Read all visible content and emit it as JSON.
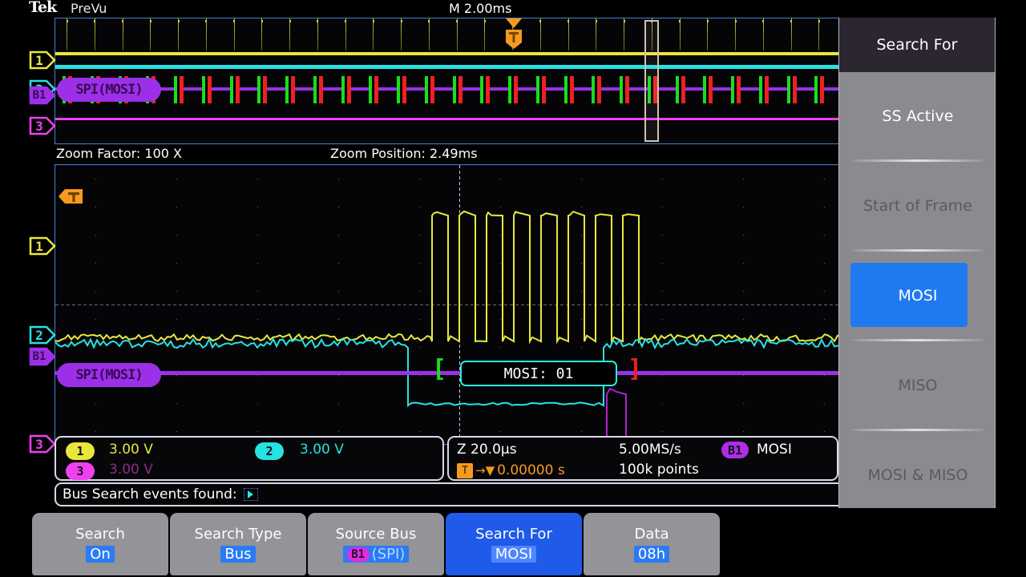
{
  "header": {
    "brand": "Tek",
    "mode": "PreVu",
    "horizontal_scale": "M 2.00ms"
  },
  "overview": {
    "bus_label": "SPI(MOSI)",
    "trigger_marker": "T",
    "channels": [
      {
        "name": "1",
        "color": "#e8e83c"
      },
      {
        "name": "2",
        "color": "#27e2e2"
      },
      {
        "name": "B1",
        "color": "#9b30e8"
      },
      {
        "name": "3",
        "color": "#f040f0"
      }
    ]
  },
  "zoom_info": {
    "factor_label": "Zoom Factor: 100 X",
    "position_label": "Zoom Position: 2.49ms"
  },
  "zoom_view": {
    "trigger_marker": "T",
    "bus_label": "SPI(MOSI)",
    "decode_value": "MOSI: 01",
    "bracket_start": "[",
    "bracket_end": "]",
    "channels": [
      {
        "name": "1",
        "color": "#e8e83c"
      },
      {
        "name": "2",
        "color": "#27e2e2"
      },
      {
        "name": "B1",
        "color": "#9b30e8"
      },
      {
        "name": "3",
        "color": "#f040f0"
      }
    ]
  },
  "readout_left": {
    "ch1": {
      "pill": "1",
      "value": "3.00 V",
      "pill_color": "#e8e83c",
      "text_color": "#e8e83c"
    },
    "ch2": {
      "pill": "2",
      "value": "3.00 V",
      "pill_color": "#27e2e2",
      "text_color": "#27e2e2"
    },
    "ch3": {
      "pill": "3",
      "value": "3.00 V",
      "pill_color": "#f040f0",
      "text_color": "#8e2a8e"
    }
  },
  "readout_right": {
    "zoom_timebase": "Z 20.0µs",
    "trigger_pos": "0.00000 s",
    "trigger_icon": "T",
    "sample_rate": "5.00MS/s",
    "record_length": "100k points",
    "bus_pill": "B1",
    "bus_name": "MOSI"
  },
  "events_row": {
    "label": "Bus Search events found:",
    "marker_icon": "search-event-marker-icon"
  },
  "side_menu": {
    "title": "Search For",
    "items": [
      {
        "label": "SS Active",
        "state": "enabled"
      },
      {
        "label": "Start of Frame",
        "state": "dimmed"
      },
      {
        "label": "MOSI",
        "state": "selected"
      },
      {
        "label": "MISO",
        "state": "dimmed"
      },
      {
        "label": "MOSI & MISO",
        "state": "dimmed"
      }
    ]
  },
  "bezel_buttons": [
    {
      "title": "Search",
      "value": "On",
      "selected": false,
      "pill": null
    },
    {
      "title": "Search Type",
      "value": "Bus",
      "selected": false,
      "pill": null
    },
    {
      "title": "Source Bus",
      "value": "(SPI)",
      "selected": false,
      "pill": "B1"
    },
    {
      "title": "Search For",
      "value": "MOSI",
      "selected": true,
      "pill": null
    },
    {
      "title": "Data",
      "value": "08h",
      "selected": false,
      "pill": null
    }
  ],
  "colors": {
    "ch1": "#e8e83c",
    "ch2": "#27e2e2",
    "ch3": "#f040f0",
    "bus": "#9b30e8",
    "trigger": "#f59a1e",
    "accent_blue": "#1f7af0",
    "graticule_border": "#4a7fd4"
  }
}
